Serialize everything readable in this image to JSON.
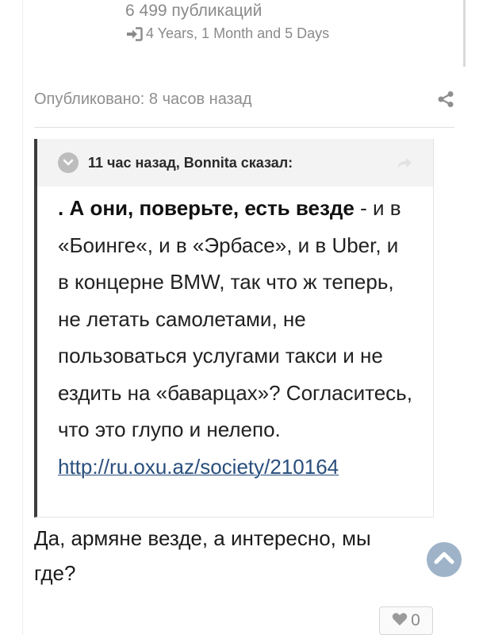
{
  "author": {
    "post_count": "6 499 публикаций",
    "tenure": "4 Years, 1 Month and 5 Days"
  },
  "post": {
    "published": "Опубликовано: 8 часов назад"
  },
  "quote": {
    "header": "11 час назад, Bonnita сказал:",
    "lead_bold": ". А они, поверьте, есть везде",
    "body": " - и в «Боинге«, и в «Эрбасе», и в Uber, и в концерне BMW, так что ж теперь, не летать самолетами, не пользоваться услугами такси и не ездить на «баварцах»? Согласитесь, что это глупо и нелепо.",
    "link": "http://ru.oxu.az/society/210164"
  },
  "reply": {
    "text": "Да, армяне везде, а интересно, мы где?"
  },
  "reaction": {
    "icon": "heart-icon",
    "count": "0"
  },
  "colors": {
    "quote_bar": "#3d3d3d",
    "link": "#2a4f7d",
    "scroll_top_bg": "#9fb3c8",
    "muted_text": "#8a8a8a"
  }
}
